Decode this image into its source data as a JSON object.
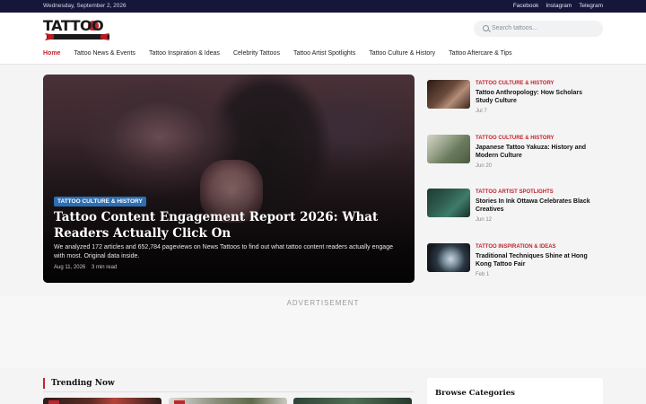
{
  "topbar": {
    "date": "Wednesday, September 2, 2026",
    "social": [
      "Facebook",
      "Instagram",
      "Telegram"
    ]
  },
  "brand": {
    "logo_text": "TATTOO",
    "logo_sub": "NEWS",
    "accent": "#c0262e",
    "dark": "#16163a"
  },
  "search": {
    "placeholder": "Search tattoos..."
  },
  "nav": {
    "items": [
      "Home",
      "Tattoo News & Events",
      "Tattoo Inspiration & Ideas",
      "Celebrity Tattoos",
      "Tattoo Artist Spotlights",
      "Tattoo Culture & History",
      "Tattoo Aftercare & Tips"
    ],
    "active": "Home"
  },
  "hero": {
    "category": "TATTOO CULTURE & HISTORY",
    "title": "Tattoo Content Engagement Report 2026: What Readers Actually Click On",
    "excerpt": "We analyzed 172 articles and 652,784 pageviews on News Tattoos to find out what tattoo content readers actually engage with most. Original data inside.",
    "date": "Aug 11, 2026",
    "read_time": "3 min read"
  },
  "side_posts": [
    {
      "category": "TATTOO CULTURE & HISTORY",
      "title": "Tattoo Anthropology: How Scholars Study Culture",
      "date": "Jul 7"
    },
    {
      "category": "TATTOO CULTURE & HISTORY",
      "title": "Japanese Tattoo Yakuza: History and Modern Culture",
      "date": "Jun 20"
    },
    {
      "category": "TATTOO ARTIST SPOTLIGHTS",
      "title": "Stories In Ink Ottawa Celebrates Black Creatives",
      "date": "Jun 12"
    },
    {
      "category": "TATTOO INSPIRATION & IDEAS",
      "title": "Traditional Techniques Shine at Hong Kong Tattoo Fair",
      "date": "Feb 1"
    }
  ],
  "ad": {
    "label": "ADVERTISEMENT"
  },
  "trending": {
    "title": "Trending Now"
  },
  "sidebar": {
    "browse_title": "Browse Categories"
  }
}
